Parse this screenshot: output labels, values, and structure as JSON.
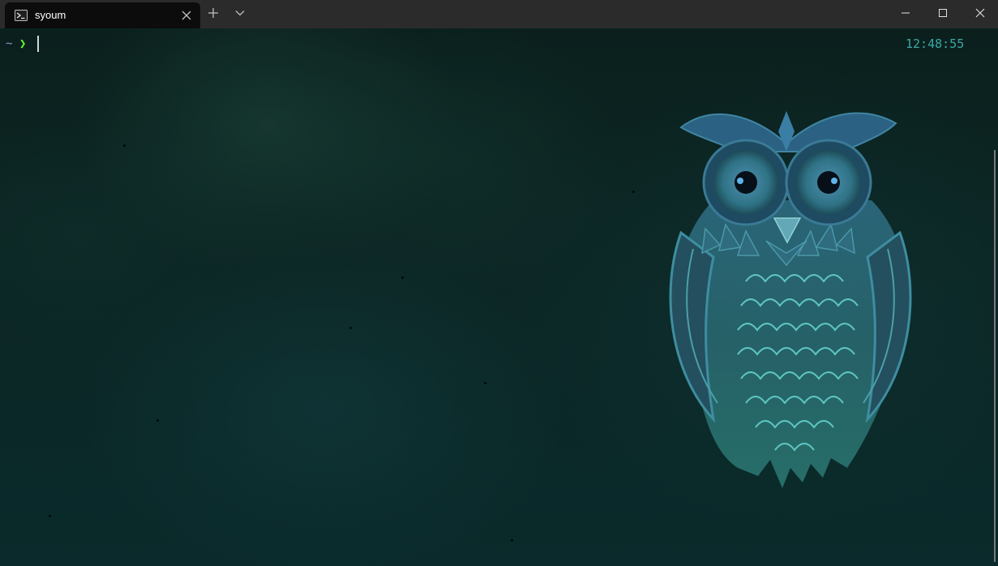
{
  "tab": {
    "title": "syoum",
    "icon": "powershell-icon"
  },
  "titlebar": {
    "new_tab_icon": "plus-icon",
    "dropdown_icon": "chevron-down-icon",
    "minimize_icon": "minimize-icon",
    "maximize_icon": "maximize-icon",
    "close_icon": "close-icon"
  },
  "terminal": {
    "prompt_path": "~",
    "prompt_symbol": "❯",
    "clock": "12:48:55"
  },
  "colors": {
    "titlebar": "#2b2b2b",
    "tab": "#0c0c0c",
    "prompt_path": "#7f9bd1",
    "prompt_symbol": "#66ff33",
    "clock": "#3aa9a6"
  }
}
